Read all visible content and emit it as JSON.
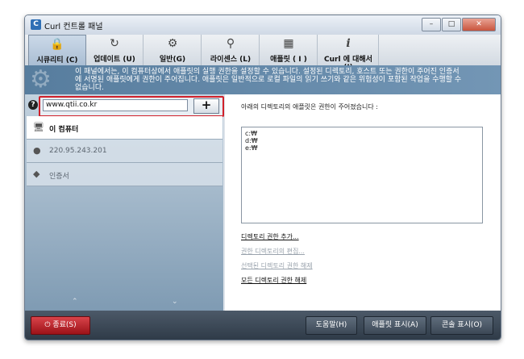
{
  "window": {
    "title": "Curl 컨트롤 패널"
  },
  "tabs": [
    {
      "label": "시큐리티 (C)",
      "icon": "lock-icon",
      "active": true
    },
    {
      "label": "업데이트 (U)",
      "icon": "update-icon"
    },
    {
      "label": "일반(G)",
      "icon": "gear-icon"
    },
    {
      "label": "라이센스 (L)",
      "icon": "key-icon"
    },
    {
      "label": "애플릿 ( I )",
      "icon": "applet-icon"
    },
    {
      "label": "Curl 에 대해서 (I)",
      "icon": "info-icon"
    }
  ],
  "info": {
    "text": "이 패널에서는, 이 컴퓨터상에서 애플릿의 실행 권한을 설정할 수 있습니다. 설정된 디렉토리, 호스트 또는 권한이 주어진 인증서에 서명된 애플릿에게 권한이 주어집니다. 애플릿은 일반적으로 로컬 파일의 읽기 쓰기와 같은 위험성이 포함된 작업을 수행할 수 없습니다."
  },
  "url_input": {
    "value": "www.qtii.co.kr"
  },
  "add_button": {
    "label": "+"
  },
  "nav": [
    {
      "label": "이 컴퓨터",
      "icon": "computer-icon"
    },
    {
      "label": "220.95.243.201",
      "icon": "globe-icon"
    },
    {
      "label": "인증서",
      "icon": "certificate-tag-icon"
    }
  ],
  "right": {
    "heading": "아래의 디렉토리의 애플릿은 권한이 주어졌습니다 :",
    "directories": [
      "c:₩",
      "d:₩",
      "e:₩"
    ],
    "links": [
      {
        "label": "디렉토리 권한 추가...",
        "enabled": true
      },
      {
        "label": "권한 디렉토리의 편집...",
        "enabled": false
      },
      {
        "label": "선택된 디렉토리 권한 해제",
        "enabled": false
      },
      {
        "label": "모든 디렉토리 권한 해제",
        "enabled": true
      }
    ]
  },
  "bottom": {
    "exit": "종료(S)",
    "help": "도움말(H)",
    "show_applet": "애플릿 표시(A)",
    "show_console": "콘솔 표시(O)"
  },
  "colors": {
    "accent": "#577d9e",
    "highlight_border": "#d0202a",
    "exit_button": "#b8242b"
  }
}
